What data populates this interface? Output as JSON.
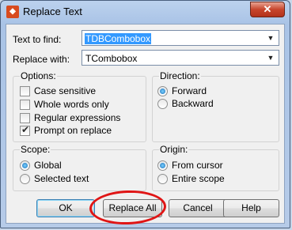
{
  "window": {
    "title": "Replace Text",
    "close_symbol": "✕"
  },
  "find": {
    "label": "Text to find:",
    "value": "TDBCombobox"
  },
  "replace": {
    "label": "Replace with:",
    "value": "TCombobox"
  },
  "options": {
    "title": "Options:",
    "items": [
      {
        "label": "Case sensitive",
        "checked": false
      },
      {
        "label": "Whole words only",
        "checked": false
      },
      {
        "label": "Regular expressions",
        "checked": false
      },
      {
        "label": "Prompt on replace",
        "checked": true
      }
    ]
  },
  "direction": {
    "title": "Direction:",
    "items": [
      {
        "label": "Forward",
        "selected": true
      },
      {
        "label": "Backward",
        "selected": false
      }
    ]
  },
  "scope": {
    "title": "Scope:",
    "items": [
      {
        "label": "Global",
        "selected": true
      },
      {
        "label": "Selected text",
        "selected": false
      }
    ]
  },
  "origin": {
    "title": "Origin:",
    "items": [
      {
        "label": "From cursor",
        "selected": true
      },
      {
        "label": "Entire scope",
        "selected": false
      }
    ]
  },
  "buttons": {
    "ok": "OK",
    "replace_all": "Replace All",
    "cancel": "Cancel",
    "help": "Help"
  },
  "highlight_color": "#e01515"
}
